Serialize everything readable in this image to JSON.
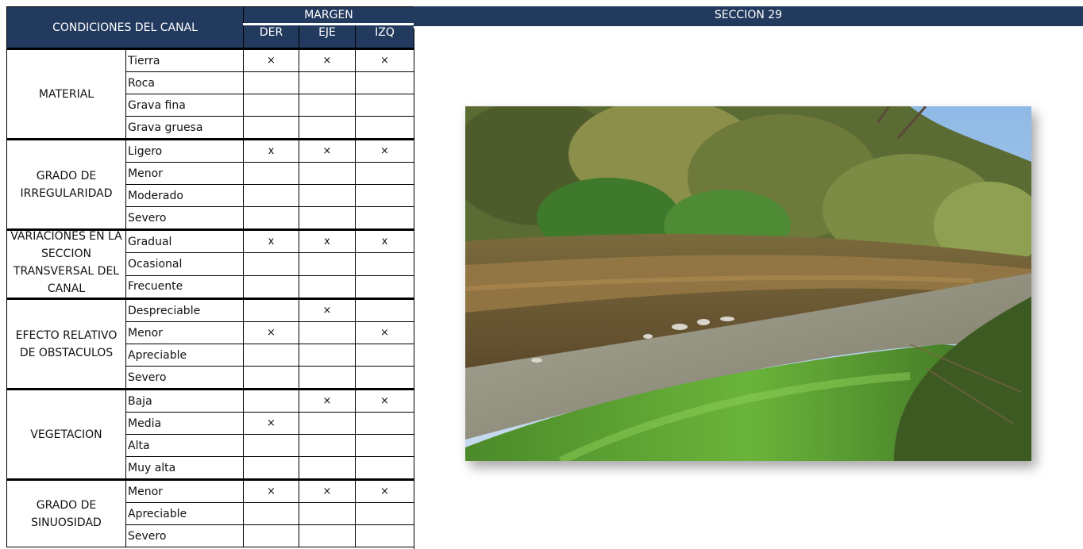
{
  "header": {
    "condiciones_label": "CONDICIONES DEL CANAL",
    "margen_label": "MARGEN",
    "margin_columns": [
      "DER",
      "EJE",
      "IZQ"
    ],
    "section_title": "SECCION 29"
  },
  "groups": [
    {
      "name": "MATERIAL",
      "rows": [
        {
          "option": "Tierra",
          "der": "×",
          "eje": "×",
          "izq": "×"
        },
        {
          "option": "Roca",
          "der": "",
          "eje": "",
          "izq": ""
        },
        {
          "option": "Grava fina",
          "der": "",
          "eje": "",
          "izq": ""
        },
        {
          "option": "Grava gruesa",
          "der": "",
          "eje": "",
          "izq": ""
        }
      ]
    },
    {
      "name": "GRADO DE IRREGULARIDAD",
      "rows": [
        {
          "option": "Ligero",
          "der": "x",
          "eje": "×",
          "izq": "×"
        },
        {
          "option": "Menor",
          "der": "",
          "eje": "",
          "izq": ""
        },
        {
          "option": "Moderado",
          "der": "",
          "eje": "",
          "izq": ""
        },
        {
          "option": "Severo",
          "der": "",
          "eje": "",
          "izq": ""
        }
      ]
    },
    {
      "name": "VARIACIONES EN LA SECCION TRANSVERSAL DEL CANAL",
      "rows": [
        {
          "option": "Gradual",
          "der": "x",
          "eje": "x",
          "izq": "x"
        },
        {
          "option": "Ocasional",
          "der": "",
          "eje": "",
          "izq": ""
        },
        {
          "option": "Frecuente",
          "der": "",
          "eje": "",
          "izq": ""
        }
      ]
    },
    {
      "name": "EFECTO RELATIVO DE OBSTACULOS",
      "rows": [
        {
          "option": "Despreciable",
          "der": "",
          "eje": "×",
          "izq": ""
        },
        {
          "option": "Menor",
          "der": "×",
          "eje": "",
          "izq": "×"
        },
        {
          "option": "Apreciable",
          "der": "",
          "eje": "",
          "izq": ""
        },
        {
          "option": "Severo",
          "der": "",
          "eje": "",
          "izq": ""
        }
      ]
    },
    {
      "name": "VEGETACION",
      "rows": [
        {
          "option": "Baja",
          "der": "",
          "eje": "×",
          "izq": "×"
        },
        {
          "option": "Media",
          "der": "×",
          "eje": "",
          "izq": ""
        },
        {
          "option": "Alta",
          "der": "",
          "eje": "",
          "izq": ""
        },
        {
          "option": "Muy alta",
          "der": "",
          "eje": "",
          "izq": ""
        }
      ]
    },
    {
      "name": "GRADO DE SINUOSIDAD",
      "rows": [
        {
          "option": "Menor",
          "der": "×",
          "eje": "×",
          "izq": "×"
        },
        {
          "option": "Apreciable",
          "der": "",
          "eje": "",
          "izq": ""
        },
        {
          "option": "Severo",
          "der": "",
          "eje": "",
          "izq": ""
        }
      ]
    }
  ],
  "colors": {
    "header_bg": "#223a5e",
    "header_text": "#ffffff"
  }
}
